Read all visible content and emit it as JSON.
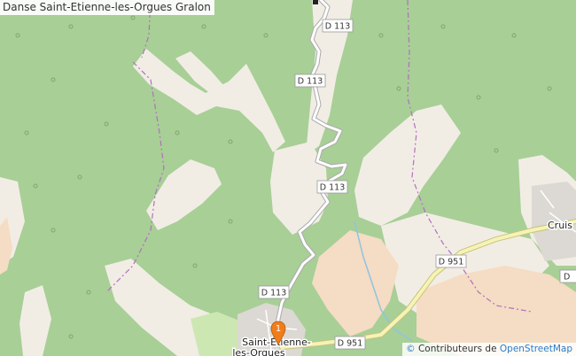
{
  "title": "Danse Saint-Etienne-les-Orgues Gralon",
  "roads": {
    "d113_a": "D 113",
    "d113_b": "D 113",
    "d113_c": "D 113",
    "d113_d": "D 113",
    "d951_a": "D 951",
    "d951_b": "D 951",
    "d_right": "D"
  },
  "places": {
    "town_line1": "Saint-Étienne-",
    "town_line2": "les-Orgues",
    "cruis": "Cruis"
  },
  "marker": {
    "label": "1",
    "color": "#f07d1a"
  },
  "attribution": {
    "info_icon": "©",
    "prefix": "Contributeurs de",
    "link": "OpenStreetMap"
  },
  "colors": {
    "forest": "#a8cf96",
    "clearing": "#f1ede5",
    "farmland": "#f5dcc4",
    "road_primary": "#f5f3b5",
    "road_secondary": "#ffffff",
    "boundary": "#b36fc0"
  }
}
